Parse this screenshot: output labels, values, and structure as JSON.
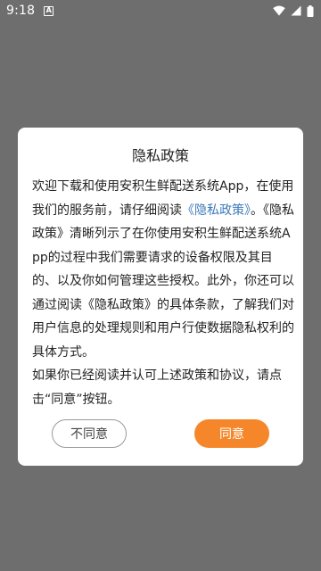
{
  "status_bar": {
    "time": "9:18",
    "notification_glyph": "A",
    "icons": [
      "wifi-icon",
      "signal-icon",
      "battery-icon"
    ]
  },
  "dialog": {
    "title": "隐私政策",
    "paragraph1_before_link": "欢迎下载和使用安积生鲜配送系统App，在使用我们的服务前，请仔细阅读",
    "paragraph1_link": "《隐私政策》",
    "paragraph1_after_link": "。《隐私政策》清晰列示了在你使用安积生鲜配送系统App的过程中我们需要请求的设备权限及其目的、以及你如何管理这些授权。此外，你还可以通过阅读《隐私政策》的具体条款，了解我们对用户信息的处理规则和用户行使数据隐私权利的具体方式。",
    "paragraph2": "如果你已经阅读并认可上述政策和协议，请点击“同意”按钮。",
    "disagree_label": "不同意",
    "agree_label": "同意"
  },
  "colors": {
    "overlay": "#6e6e6e",
    "accent": "#f5872a",
    "link": "#3c7bb8"
  }
}
